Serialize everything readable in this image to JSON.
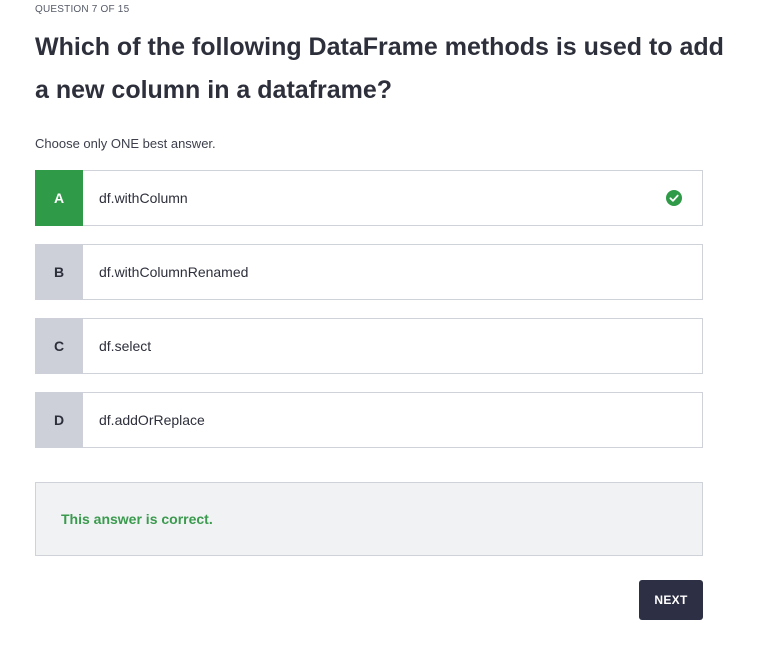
{
  "quiz": {
    "counter": "QUESTION 7 OF 15",
    "question": "Which of the following DataFrame methods is used to add a new column in a dataframe?",
    "instruction": "Choose only ONE best answer.",
    "options": [
      {
        "letter": "A",
        "text": "df.withColumn",
        "state": "correct"
      },
      {
        "letter": "B",
        "text": "df.withColumnRenamed",
        "state": "default"
      },
      {
        "letter": "C",
        "text": "df.select",
        "state": "default"
      },
      {
        "letter": "D",
        "text": "df.addOrReplace",
        "state": "default"
      }
    ],
    "feedback": "This answer is correct.",
    "next_label": "NEXT"
  },
  "icons": {
    "correct_indicator": "check-circle-icon"
  },
  "colors": {
    "correct_green": "#2f9a48",
    "feedback_green": "#3a9a4d",
    "letter_gray": "#cdd0d9",
    "button_dark": "#2d2f44",
    "feedback_bg": "#f1f2f4"
  }
}
